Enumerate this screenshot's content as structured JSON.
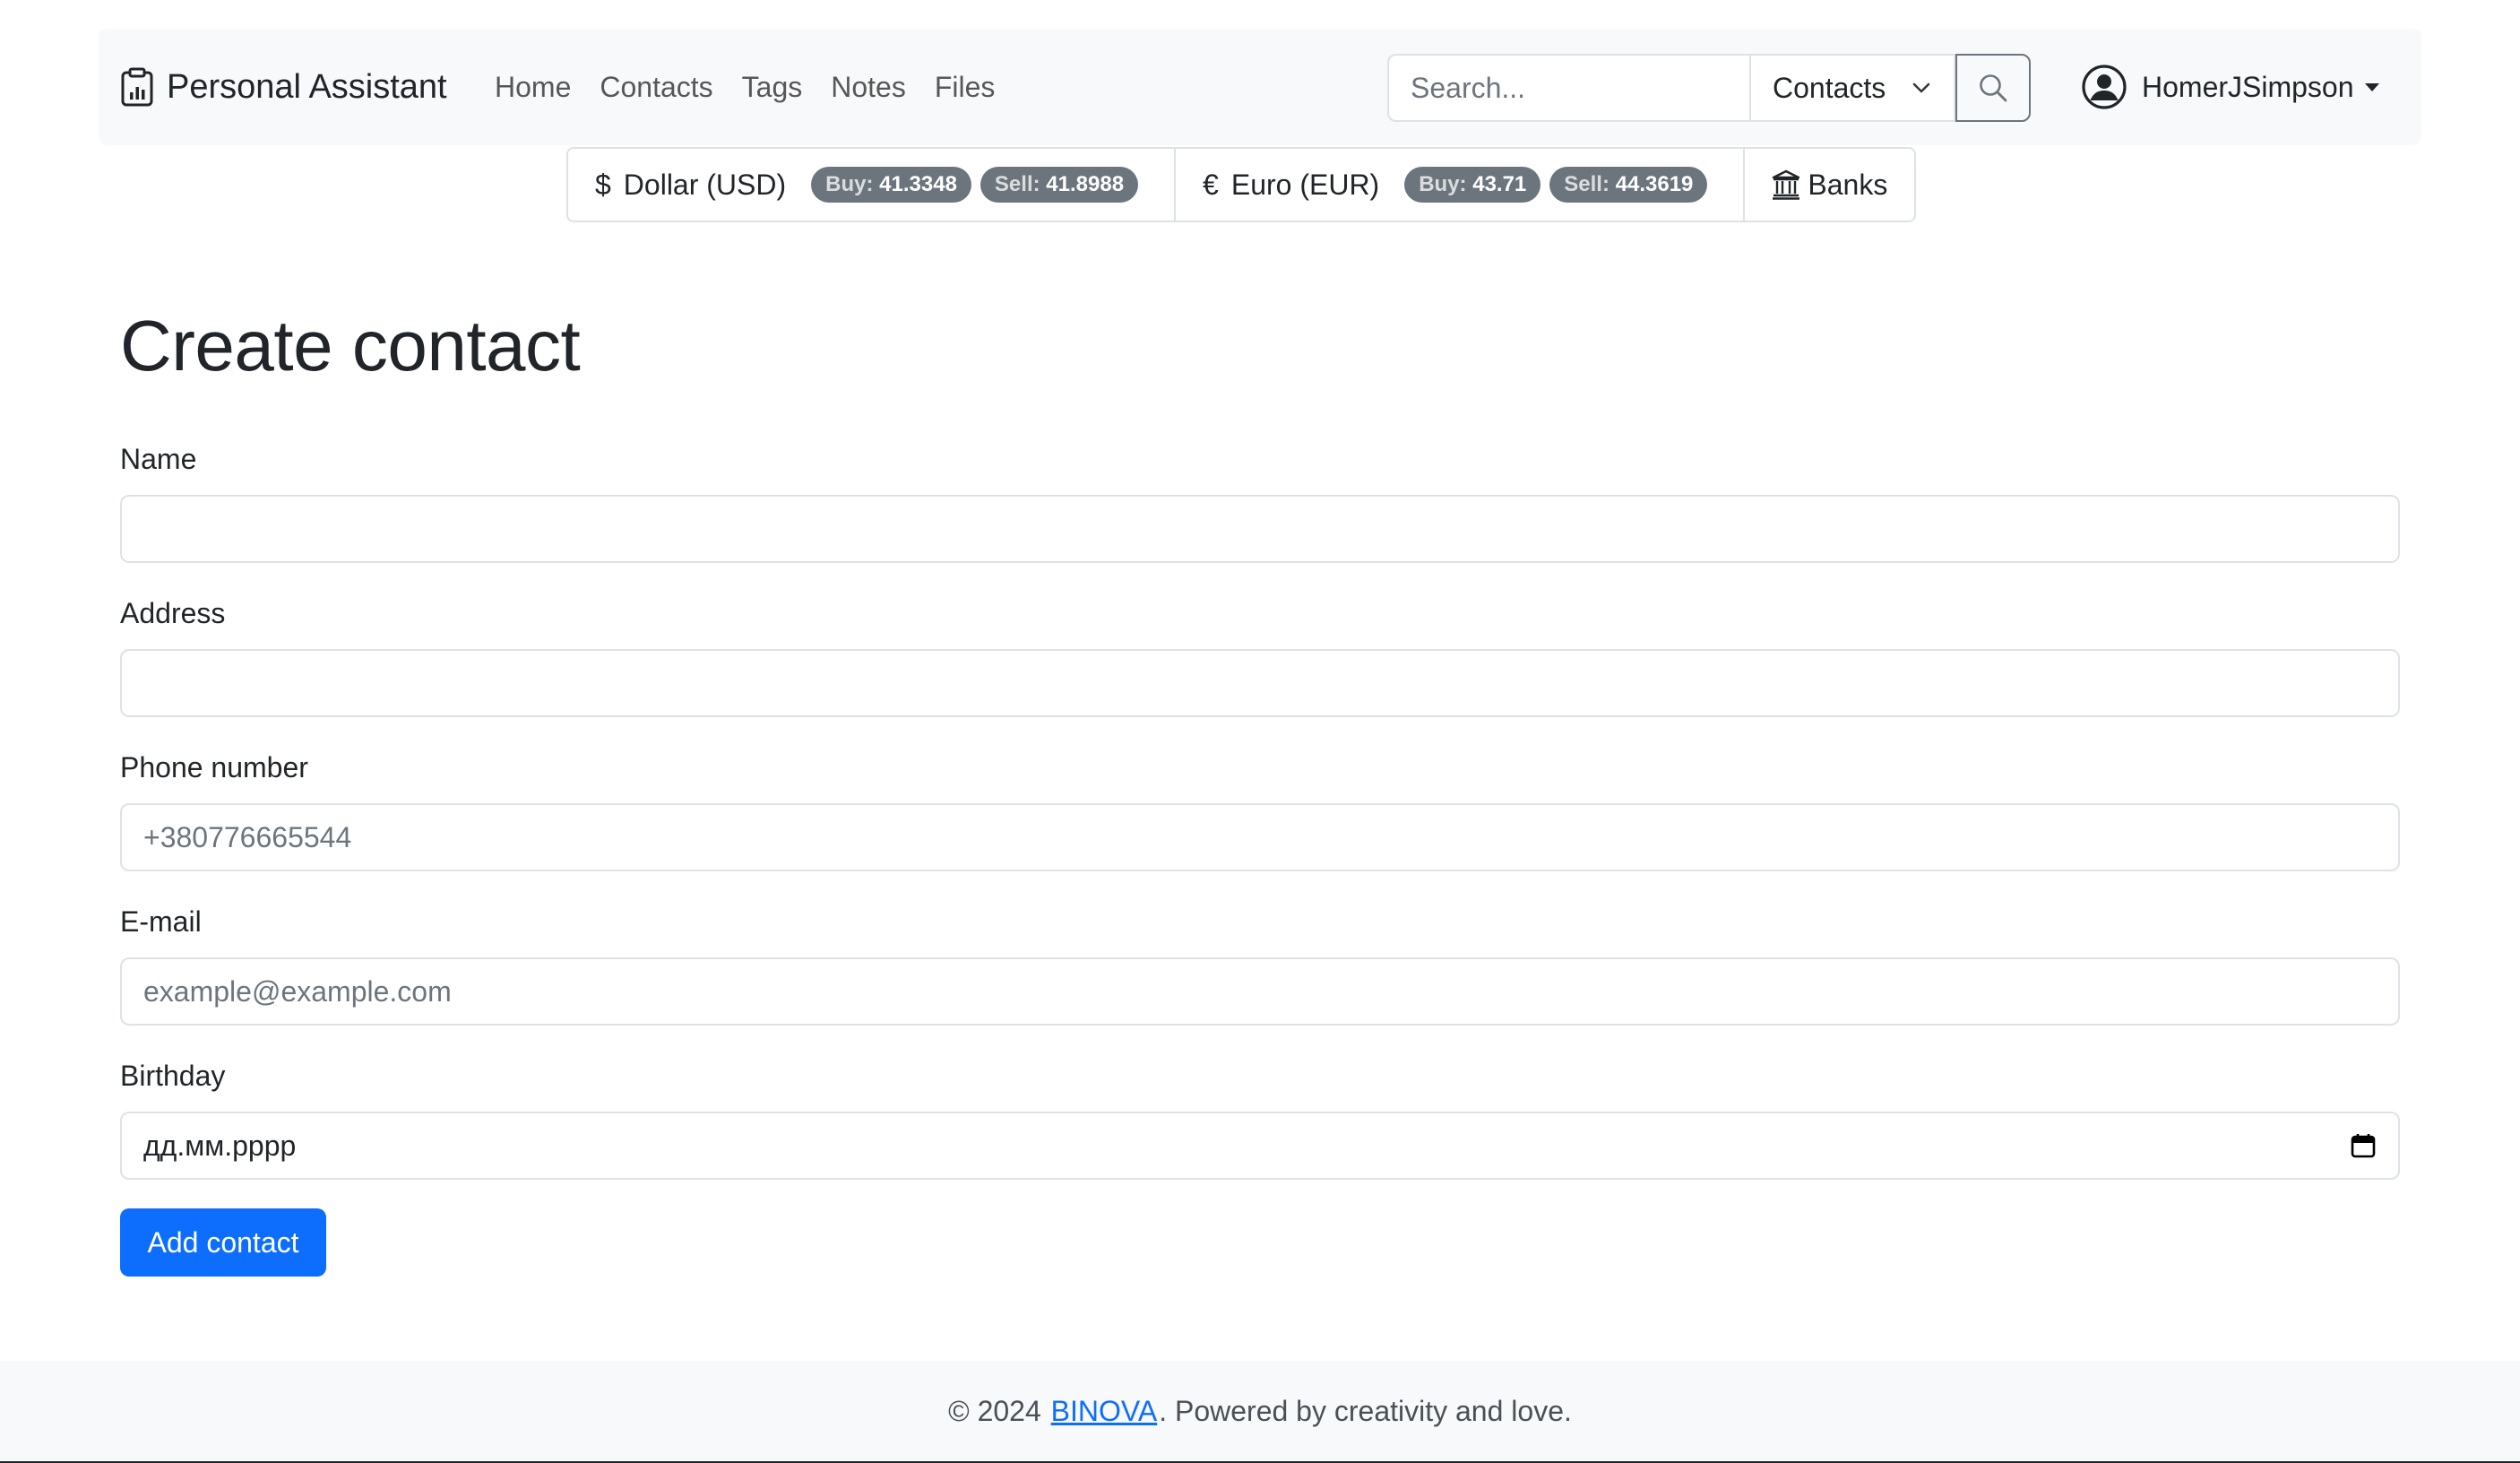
{
  "brand": {
    "title": "Personal Assistant",
    "icon": "clipboard-data-icon"
  },
  "nav": {
    "links": [
      {
        "label": "Home"
      },
      {
        "label": "Contacts"
      },
      {
        "label": "Tags"
      },
      {
        "label": "Notes"
      },
      {
        "label": "Files"
      }
    ]
  },
  "search": {
    "placeholder": "Search...",
    "category": "Contacts",
    "button_icon": "search-icon"
  },
  "user": {
    "name": "HomerJSimpson",
    "icon": "person-circle-icon"
  },
  "currency": {
    "usd": {
      "symbol": "$",
      "name": "Dollar (USD)",
      "buy_label": "Buy:",
      "buy": "41.3348",
      "sell_label": "Sell:",
      "sell": "41.8988"
    },
    "eur": {
      "symbol": "€",
      "name": "Euro (EUR)",
      "buy_label": "Buy:",
      "buy": "43.71",
      "sell_label": "Sell:",
      "sell": "44.3619"
    },
    "banks": {
      "label": "Banks",
      "icon": "bank-icon"
    }
  },
  "page": {
    "title": "Create contact"
  },
  "form": {
    "name": {
      "label": "Name",
      "value": "",
      "placeholder": ""
    },
    "address": {
      "label": "Address",
      "value": "",
      "placeholder": ""
    },
    "phone": {
      "label": "Phone number",
      "value": "",
      "placeholder": "+380776665544"
    },
    "email": {
      "label": "E-mail",
      "value": "",
      "placeholder": "example@example.com"
    },
    "birthday": {
      "label": "Birthday",
      "display": "дд.мм.рррр",
      "icon": "calendar-icon"
    },
    "submit_label": "Add contact"
  },
  "footer": {
    "prefix": "© 2024 ",
    "link": "BINOVA",
    "suffix": ". Powered by creativity and love."
  },
  "colors": {
    "primary": "#0d6efd",
    "navbar_bg": "#f8f9fa",
    "badge_bg": "#6c757d",
    "border": "#dee2e6"
  }
}
